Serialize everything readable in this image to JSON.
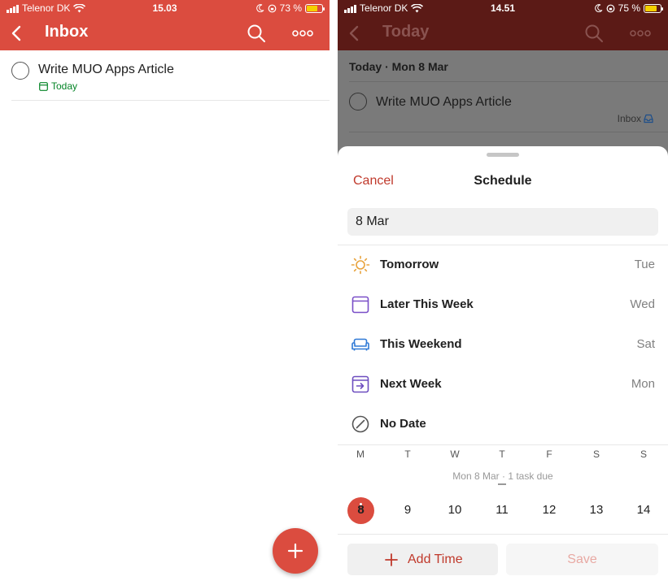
{
  "colors": {
    "brand_red": "#db4c3f",
    "header_dimmed": "#5b1a16",
    "due_green": "#058527",
    "cancel_red": "#c0392b",
    "sun_orange": "#e8a33d",
    "later_purple": "#7a4fc8",
    "weekend_blue": "#2e79d6",
    "nextweek_purple": "#6d4dbf"
  },
  "left": {
    "status": {
      "carrier": "Telenor DK",
      "time": "15.03",
      "battery": "73 %",
      "battery_level": 0.73
    },
    "header": {
      "title": "Inbox"
    },
    "task": {
      "title": "Write MUO Apps Article",
      "due": "Today"
    }
  },
  "right": {
    "status": {
      "carrier": "Telenor DK",
      "time": "14.51",
      "battery": "75 %",
      "battery_level": 0.75
    },
    "header": {
      "title": "Today"
    },
    "background": {
      "section": "Today · Mon 8 Mar",
      "task": "Write MUO Apps Article",
      "project": "Inbox"
    },
    "sheet": {
      "cancel": "Cancel",
      "title": "Schedule",
      "date_value": "8 Mar",
      "options": [
        {
          "label": "Tomorrow",
          "day": "Tue",
          "icon": "sun-icon"
        },
        {
          "label": "Later This Week",
          "day": "Wed",
          "icon": "calendar-later-icon"
        },
        {
          "label": "This Weekend",
          "day": "Sat",
          "icon": "couch-icon"
        },
        {
          "label": "Next Week",
          "day": "Mon",
          "icon": "next-week-icon"
        },
        {
          "label": "No Date",
          "day": "",
          "icon": "no-date-icon"
        }
      ],
      "weekdays": [
        "M",
        "T",
        "W",
        "T",
        "F",
        "S",
        "S"
      ],
      "cal_note": "Mon 8 Mar · 1 task due",
      "days": [
        "8",
        "9",
        "10",
        "11",
        "12",
        "13",
        "14"
      ],
      "add_time": "Add Time",
      "save": "Save"
    }
  }
}
